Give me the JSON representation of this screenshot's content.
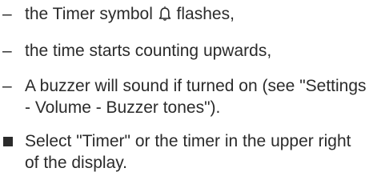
{
  "list": {
    "items": [
      {
        "marker": "–",
        "before_icon": "the Timer symbol ",
        "icon": "bell-icon",
        "after_icon": " flashes,"
      },
      {
        "marker": "–",
        "text": "the time starts counting upwards,"
      },
      {
        "marker": "–",
        "text": "A buzzer will sound if turned on (see \"Settings - Volume - Buzzer tones\")."
      }
    ]
  },
  "step": {
    "text": "Select \"Timer\" or the timer in the upper right of the display."
  }
}
